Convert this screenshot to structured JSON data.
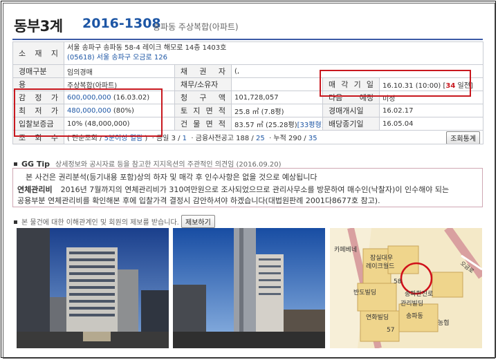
{
  "header": {
    "court": "동부3계",
    "case_no": "2016-1308",
    "subtitle": "송파동 주상복합(아파트)"
  },
  "rows": {
    "location_label": "소 재 지",
    "address_line1": "서울 송파구 송파동 58-4 레이크 해모로 14층 1403호",
    "address_line2": "(05618) 서울 송파구 오금로 126",
    "auction_type_label": "경매구분",
    "auction_type_value": "임의경매",
    "creditor_label": "채 권 자",
    "creditor_value": "(,",
    "use_label": "용",
    "use_value": "주상복합(아파트)",
    "debtor_label": "채무/소유자",
    "sale_date_label": "매 각 기 일",
    "sale_date_value": "16.10.31 (10:00) [",
    "sale_date_days": "34",
    "sale_date_suffix": " 일전]",
    "appraisal_label": "감 정 가",
    "appraisal_value": "600,000,000",
    "appraisal_date": "(16.03.02)",
    "claim_label": "청 구 액",
    "claim_value": "101,728,057",
    "case_received_label": "다음 예정",
    "case_received_value": "미정",
    "min_price_label": "최 저 가",
    "min_price_value": "480,000,000",
    "min_price_pct": "(80%)",
    "land_area_label": "토 지 면 적",
    "land_area_value": "25.8 ㎡ (7.8평)",
    "start_date_label": "경매개시일",
    "start_date_value": "16.02.17",
    "deposit_label": "입찰보증금",
    "deposit_value": "10% (48,000,000)",
    "building_area_label": "건 물 면 적",
    "building_area_value": "83.57 ㎡ (25.28평)",
    "building_area_extra": "[33평형]",
    "dividend_label": "배당종기일",
    "dividend_value": "16.05.04",
    "views_label": "조 회 수",
    "views_open": "( 단순조회 / ",
    "views_detail": "5분이상 열람",
    "views_close": " )",
    "views_today_label": "· 금일",
    "views_today": "3",
    "views_today_sep": " / ",
    "views_today2": "1",
    "views_bank_label": "· 금융사전공고",
    "views_bank": "188",
    "views_bank2": "25",
    "views_total_label": "· 누적",
    "views_total": "290",
    "views_total2": "35",
    "stats_button": "조회통계"
  },
  "tip": {
    "title": "GG Tip",
    "desc": "상세정보와 공시자료 등을 참고한 지지옥션의 주관적인 의견임 (2016.09.20)",
    "line1": "본 사건은 권리분석(등기내용 포함)상의 하자 및 매각 후 인수사항은 없을 것으로 예상됩니다",
    "line2_title": "연체관리비",
    "line2": "2016년 7월까지의 연체관리비가 310여만원으로 조사되었으므로 관리사무소를 방문하여 매수인(낙찰자)이 인수해야 되는",
    "line3": "공용부분 연체관리비를 확인해본 후에 입찰가격 결정시 감안하셔야 하겠습니다(대법원판례 2001다8677호 참고)."
  },
  "report": {
    "text": "본 물건에 대한 이해관계인 및 회원의 제보를 받습니다.",
    "button": "제보하기"
  },
  "map": {
    "labels": {
      "cafe": "카페베네",
      "lake1": "잠실대우",
      "lake2": "레이크월드",
      "num": "58",
      "bandi": "반도빌딩",
      "yeonhwa": "연화빌딩",
      "songpa": "송파한진로",
      "gwallyo": "관리빌딩",
      "nam": "송파동",
      "n57": "57",
      "nhyup": "농협",
      "ogeum": "오금로"
    }
  },
  "colors": {
    "accent": "#1d56a5",
    "highlight": "#c8171e"
  }
}
